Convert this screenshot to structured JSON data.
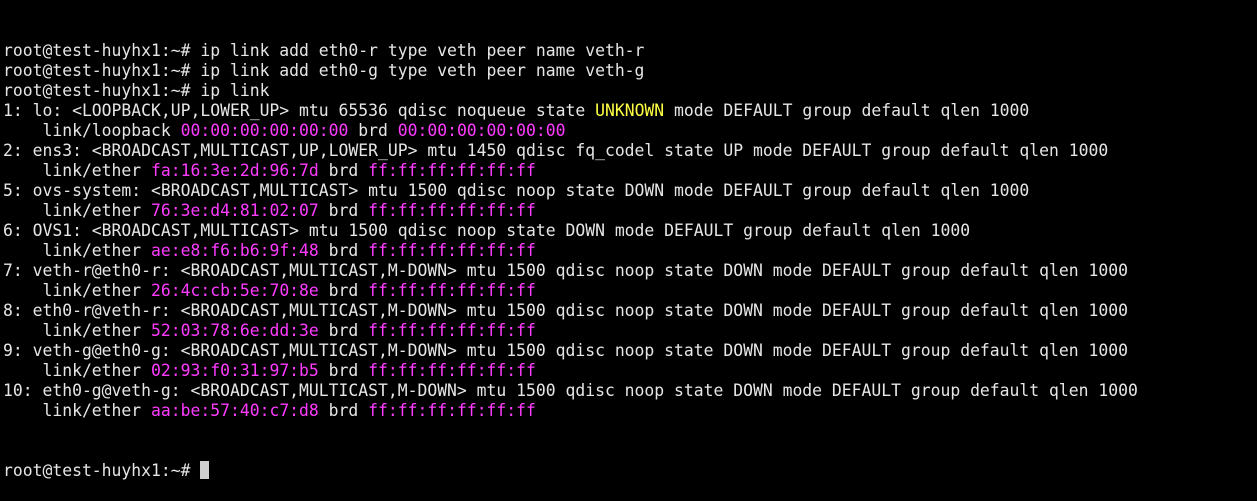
{
  "colors": {
    "background": "#000000",
    "default_text": "#e6e6e6",
    "magenta": "#ff3bff",
    "yellow": "#ffff44",
    "cursor": "#d0d0d0"
  },
  "terminal": {
    "prompt": "root@test-huyhx1:~# ",
    "lines": [
      [
        {
          "t": "root@test-huyhx1:~# ip link add eth0-r type veth peer name veth-r",
          "c": "default"
        }
      ],
      [
        {
          "t": "root@test-huyhx1:~# ip link add eth0-g type veth peer name veth-g",
          "c": "default"
        }
      ],
      [
        {
          "t": "root@test-huyhx1:~# ip link",
          "c": "default"
        }
      ],
      [
        {
          "t": "1: lo: <LOOPBACK,UP,LOWER_UP> mtu 65536 qdisc noqueue state ",
          "c": "default"
        },
        {
          "t": "UNKNOWN",
          "c": "yellow"
        },
        {
          "t": " mode DEFAULT group default qlen 1000",
          "c": "default"
        }
      ],
      [
        {
          "t": "    link/loopback ",
          "c": "default"
        },
        {
          "t": "00:00:00:00:00:00",
          "c": "magenta"
        },
        {
          "t": " brd ",
          "c": "default"
        },
        {
          "t": "00:00:00:00:00:00",
          "c": "magenta"
        }
      ],
      [
        {
          "t": "2: ens3: <BROADCAST,MULTICAST,UP,LOWER_UP> mtu 1450 qdisc fq_codel state UP mode DEFAULT group default qlen 1000",
          "c": "default"
        }
      ],
      [
        {
          "t": "    link/ether ",
          "c": "default"
        },
        {
          "t": "fa:16:3e:2d:96:7d",
          "c": "magenta"
        },
        {
          "t": " brd ",
          "c": "default"
        },
        {
          "t": "ff:ff:ff:ff:ff:ff",
          "c": "magenta"
        }
      ],
      [
        {
          "t": "5: ovs-system: <BROADCAST,MULTICAST> mtu 1500 qdisc noop state DOWN mode DEFAULT group default qlen 1000",
          "c": "default"
        }
      ],
      [
        {
          "t": "    link/ether ",
          "c": "default"
        },
        {
          "t": "76:3e:d4:81:02:07",
          "c": "magenta"
        },
        {
          "t": " brd ",
          "c": "default"
        },
        {
          "t": "ff:ff:ff:ff:ff:ff",
          "c": "magenta"
        }
      ],
      [
        {
          "t": "6: OVS1: <BROADCAST,MULTICAST> mtu 1500 qdisc noop state DOWN mode DEFAULT group default qlen 1000",
          "c": "default"
        }
      ],
      [
        {
          "t": "    link/ether ",
          "c": "default"
        },
        {
          "t": "ae:e8:f6:b6:9f:48",
          "c": "magenta"
        },
        {
          "t": " brd ",
          "c": "default"
        },
        {
          "t": "ff:ff:ff:ff:ff:ff",
          "c": "magenta"
        }
      ],
      [
        {
          "t": "7: veth-r@eth0-r: <BROADCAST,MULTICAST,M-DOWN> mtu 1500 qdisc noop state DOWN mode DEFAULT group default qlen 1000",
          "c": "default"
        }
      ],
      [
        {
          "t": "    link/ether ",
          "c": "default"
        },
        {
          "t": "26:4c:cb:5e:70:8e",
          "c": "magenta"
        },
        {
          "t": " brd ",
          "c": "default"
        },
        {
          "t": "ff:ff:ff:ff:ff:ff",
          "c": "magenta"
        }
      ],
      [
        {
          "t": "8: eth0-r@veth-r: <BROADCAST,MULTICAST,M-DOWN> mtu 1500 qdisc noop state DOWN mode DEFAULT group default qlen 1000",
          "c": "default"
        }
      ],
      [
        {
          "t": "    link/ether ",
          "c": "default"
        },
        {
          "t": "52:03:78:6e:dd:3e",
          "c": "magenta"
        },
        {
          "t": " brd ",
          "c": "default"
        },
        {
          "t": "ff:ff:ff:ff:ff:ff",
          "c": "magenta"
        }
      ],
      [
        {
          "t": "9: veth-g@eth0-g: <BROADCAST,MULTICAST,M-DOWN> mtu 1500 qdisc noop state DOWN mode DEFAULT group default qlen 1000",
          "c": "default"
        }
      ],
      [
        {
          "t": "    link/ether ",
          "c": "default"
        },
        {
          "t": "02:93:f0:31:97:b5",
          "c": "magenta"
        },
        {
          "t": " brd ",
          "c": "default"
        },
        {
          "t": "ff:ff:ff:ff:ff:ff",
          "c": "magenta"
        }
      ],
      [
        {
          "t": "10: eth0-g@veth-g: <BROADCAST,MULTICAST,M-DOWN> mtu 1500 qdisc noop state DOWN mode DEFAULT group default qlen 1000",
          "c": "default"
        }
      ],
      [
        {
          "t": "    link/ether ",
          "c": "default"
        },
        {
          "t": "aa:be:57:40:c7:d8",
          "c": "magenta"
        },
        {
          "t": " brd ",
          "c": "default"
        },
        {
          "t": "ff:ff:ff:ff:ff:ff",
          "c": "magenta"
        }
      ]
    ]
  }
}
